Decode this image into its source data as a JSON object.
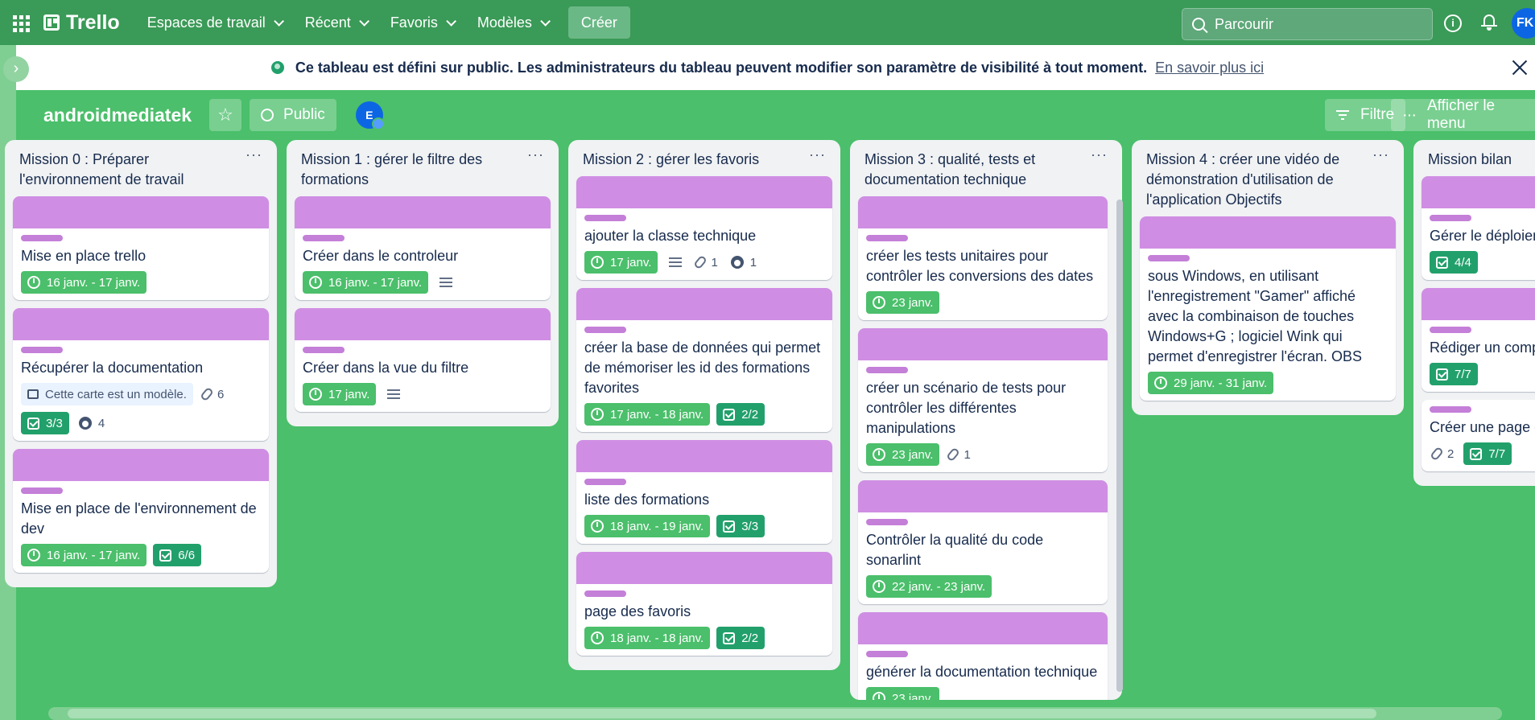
{
  "nav": {
    "brand": "Trello",
    "items": [
      "Espaces de travail",
      "Récent",
      "Favoris",
      "Modèles"
    ],
    "create": "Créer",
    "search_placeholder": "Parcourir",
    "info": "i",
    "user_initials": "FK"
  },
  "banner": {
    "text": "Ce tableau est défini sur public. Les administrateurs du tableau peuvent modifier son paramètre de visibilité à tout moment.",
    "link": "En savoir plus ici"
  },
  "board": {
    "title": "androidmediatek",
    "visibility": "Public",
    "member_initial": "E",
    "filter": "Filtre",
    "menu": "Afficher le menu"
  },
  "lists": [
    {
      "title": "Mission 0 : Préparer l'environnement de travail",
      "cards": [
        {
          "title": "Mise en place trello",
          "date": "16 janv. - 17 janv."
        },
        {
          "title": "Récupérer la documentation",
          "template": "Cette carte est un modèle.",
          "attachments": "6",
          "checklist": "3/3",
          "github": "4"
        },
        {
          "title": "Mise en place de l'environnement de dev",
          "date": "16 janv. - 17 janv.",
          "checklist": "6/6"
        }
      ]
    },
    {
      "title": "Mission 1 : gérer le filtre des formations",
      "cards": [
        {
          "title": "Créer dans le controleur",
          "date": "16 janv. - 17 janv."
        },
        {
          "title": "Créer dans la vue du filtre",
          "date": "17 janv."
        }
      ]
    },
    {
      "title": "Mission 2 : gérer les favoris",
      "cards": [
        {
          "title": "ajouter la classe technique",
          "date": "17 janv.",
          "attachments": "1",
          "github": "1"
        },
        {
          "title": "créer la base de données qui permet de mémoriser les id des formations favorites",
          "date": "17 janv. - 18 janv.",
          "checklist": "2/2"
        },
        {
          "title": "liste des formations",
          "date": "18 janv. - 19 janv.",
          "checklist": "3/3"
        },
        {
          "title": "page des favoris",
          "date": "18 janv. - 18 janv.",
          "checklist": "2/2"
        }
      ]
    },
    {
      "title": "Mission 3 : qualité, tests et documentation technique",
      "cards": [
        {
          "title": "créer les tests unitaires pour contrôler les conversions des dates",
          "date": "23 janv."
        },
        {
          "title": "créer un scénario de tests pour contrôler les différentes manipulations",
          "date": "23 janv.",
          "attachments": "1"
        },
        {
          "title": "Contrôler la qualité du code sonarlint",
          "date": "22 janv. - 23 janv."
        },
        {
          "title": "générer la documentation technique",
          "date": "23 janv."
        }
      ]
    },
    {
      "title": "Mission 4 : créer une vidéo de démonstration d'utilisation de l'application Objectifs",
      "cards": [
        {
          "title": "sous Windows, en utilisant l'enregistrement \"Gamer\" affiché avec la combinaison de touches Windows+G ; logiciel Wink qui permet d'enregistrer l'écran. OBS",
          "date": "29 janv. - 31 janv."
        }
      ]
    },
    {
      "title": "Mission bilan",
      "cards": [
        {
          "title": "Gérer le déploiem",
          "checklist": "4/4"
        },
        {
          "title": "Rédiger un comp",
          "checklist": "7/7"
        },
        {
          "title": "Créer une page d",
          "attachments": "2",
          "checklist": "7/7"
        }
      ]
    }
  ]
}
